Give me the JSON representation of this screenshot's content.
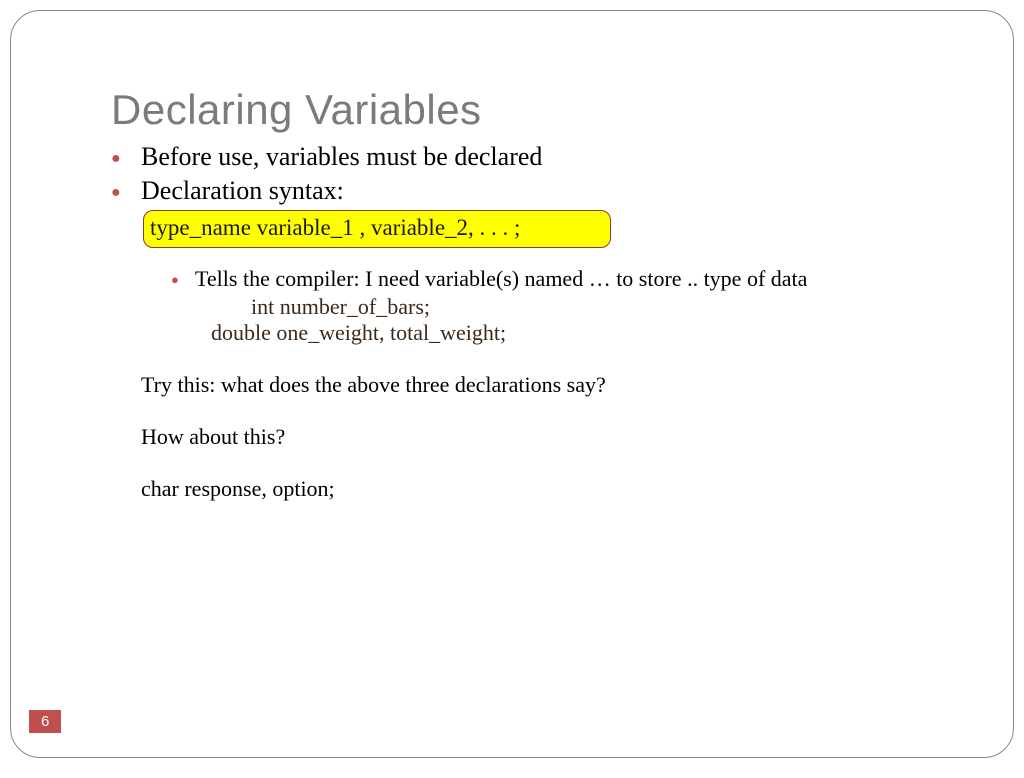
{
  "title": "Declaring Variables",
  "bullets": {
    "b1": "Before use, variables must be declared",
    "b2": "Declaration syntax:"
  },
  "syntax": "type_name  variable_1 ,  variable_2, . . . ;",
  "sub1": "Tells the compiler: I need variable(s) named … to store .. type of data",
  "code1": "int       number_of_bars;",
  "code2": "double one_weight,  total_weight;",
  "q1": "Try this: what does the above three declarations say?",
  "q2": "How about this?",
  "code3": "char   response, option;",
  "pagenum": "6"
}
